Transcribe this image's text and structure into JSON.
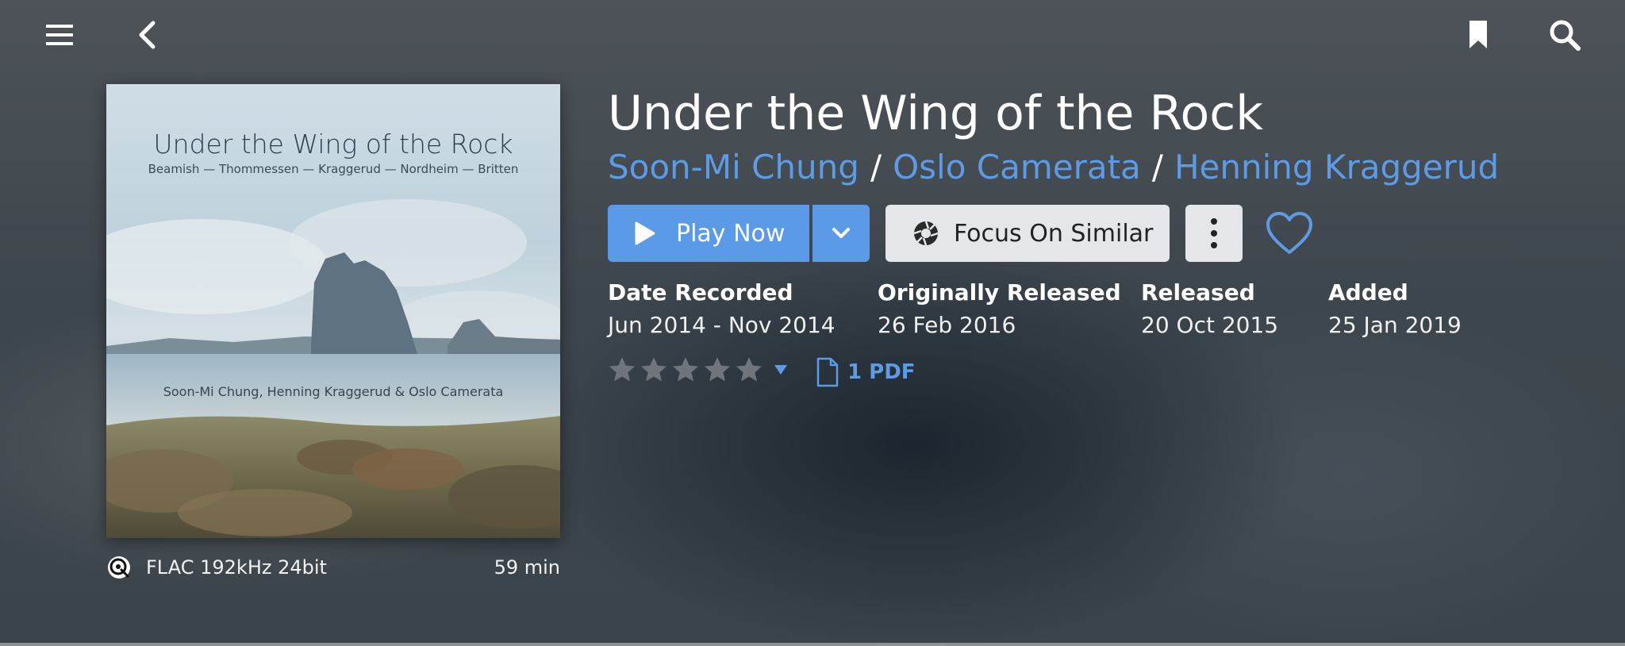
{
  "topbar": {
    "menu_icon": "hamburger-menu-icon",
    "back_icon": "chevron-left-icon",
    "bookmark_icon": "bookmark-icon",
    "search_icon": "search-icon"
  },
  "album": {
    "title": "Under the Wing of the Rock",
    "artists": [
      "Soon-Mi Chung",
      "Oslo Camerata",
      "Henning Kraggerud"
    ],
    "artist_separator": "/",
    "cover": {
      "title": "Under the Wing of the Rock",
      "composers": "Beamish — Thommessen — Kraggerud — Nordheim — Britten",
      "performers": "Soon-Mi Chung, Henning Kraggerud & Oslo Camerata"
    },
    "format": "FLAC 192kHz 24bit",
    "format_icon": "qobuz-icon",
    "duration": "59 min"
  },
  "actions": {
    "play_label": "Play Now",
    "play_icon": "play-icon",
    "play_dropdown_icon": "chevron-down-icon",
    "focus_label": "Focus On Similar",
    "focus_icon": "aperture-icon",
    "more_icon": "more-vertical-icon",
    "favorite_icon": "heart-icon"
  },
  "details": [
    {
      "label": "Date Recorded",
      "value": "Jun 2014 - Nov 2014"
    },
    {
      "label": "Originally Released",
      "value": "26 Feb 2016"
    },
    {
      "label": "Released",
      "value": "20 Oct 2015"
    },
    {
      "label": "Added",
      "value": "25 Jan 2019"
    }
  ],
  "rating": {
    "stars_total": 5,
    "stars_filled": 0
  },
  "attachments": {
    "label": "1 PDF",
    "icon": "document-icon"
  },
  "colors": {
    "accent": "#5b9ae6",
    "link": "#5d9be5",
    "button_light": "#e4e6ea"
  }
}
